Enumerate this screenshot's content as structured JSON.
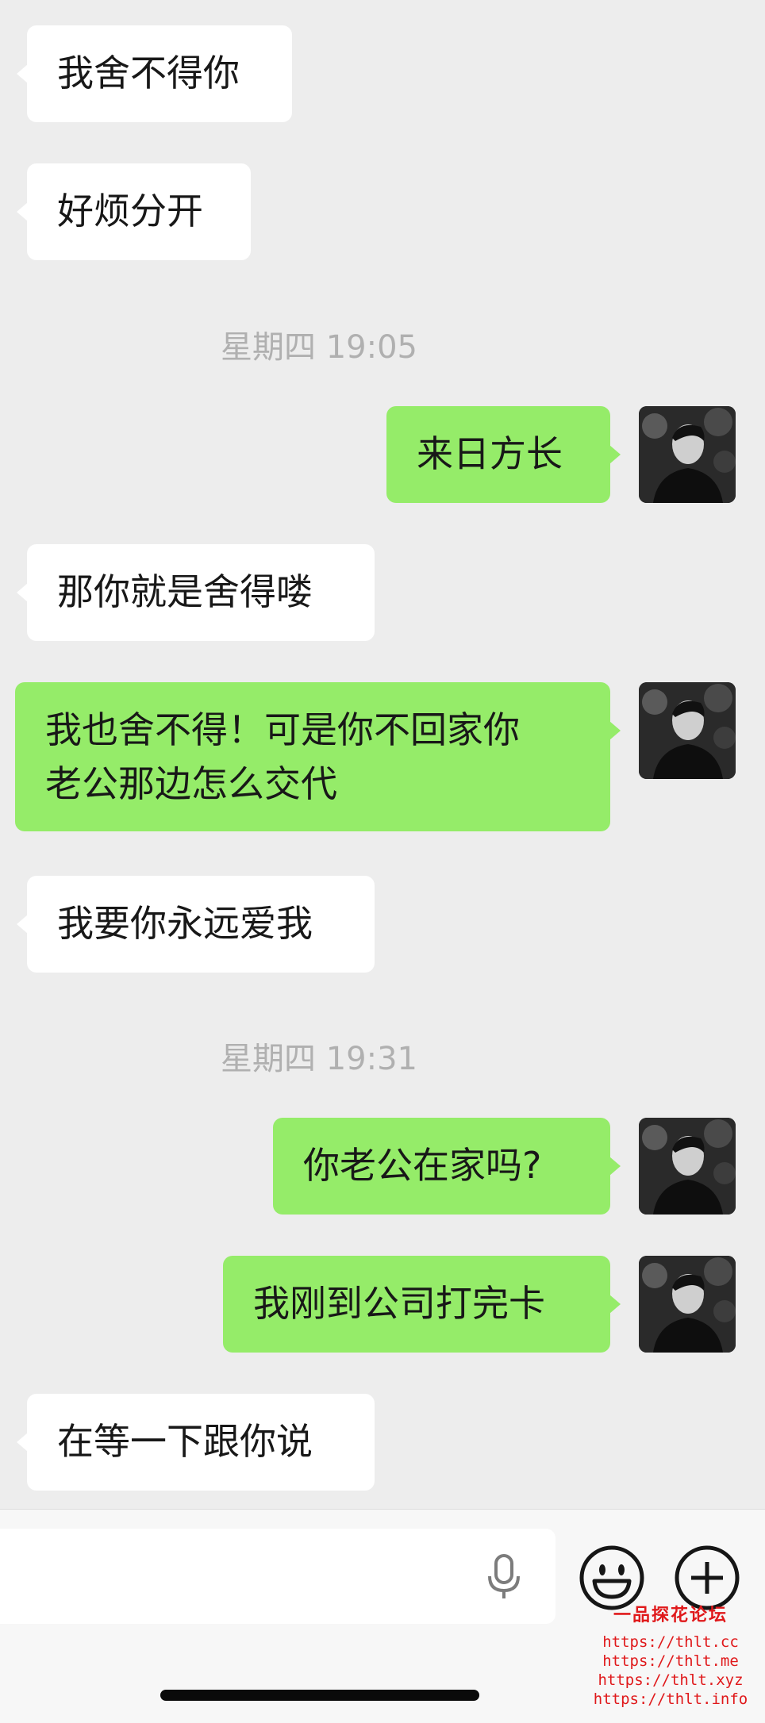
{
  "messages": [
    {
      "side": "left",
      "text": "我舍不得你"
    },
    {
      "side": "left",
      "text": "好烦分开"
    },
    {
      "type": "time",
      "text": "星期四 19:05"
    },
    {
      "side": "right",
      "text": "来日方长"
    },
    {
      "side": "left",
      "text": "那你就是舍得喽"
    },
    {
      "side": "right",
      "text_line1": "我也舍不得！可是你不回家你",
      "text_line2": "老公那边怎么交代"
    },
    {
      "side": "left",
      "text": "我要你永远爱我"
    },
    {
      "type": "time",
      "text": "星期四 19:31"
    },
    {
      "side": "right",
      "text": "你老公在家吗?"
    },
    {
      "side": "right",
      "text": "我刚到公司打完卡"
    },
    {
      "side": "left",
      "text": "在等一下跟你说"
    }
  ],
  "input_bar": {
    "icons": [
      "microphone-icon",
      "emoji-icon",
      "plus-icon"
    ]
  },
  "watermark": {
    "title": "一品探花论坛",
    "lines": [
      "https://thlt.cc",
      "https://thlt.me",
      "https://thlt.xyz",
      "https://thlt.info"
    ],
    "color": "#e0191b"
  },
  "colors": {
    "background": "#ededed",
    "incoming_bubble": "#ffffff",
    "outgoing_bubble": "#95ec69",
    "timestamp": "#b0b0b0"
  }
}
